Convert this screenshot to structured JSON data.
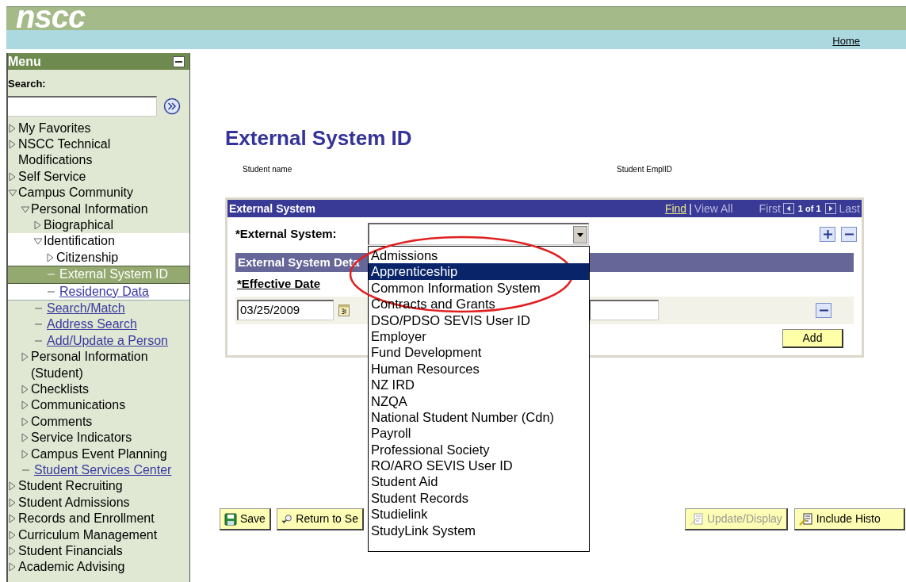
{
  "header": {
    "logo": "nscc",
    "home_link": "Home"
  },
  "menu": {
    "title": "Menu",
    "search_label": "Search:",
    "items": [
      {
        "label": "My Favorites",
        "kind": "folder",
        "expanded": false,
        "selected": false
      },
      {
        "label": "NSCC Technical Modifications",
        "kind": "folder",
        "expanded": false,
        "selected": false
      },
      {
        "label": "Self Service",
        "kind": "folder",
        "expanded": false,
        "selected": false
      },
      {
        "label": "Campus Community",
        "kind": "folder",
        "expanded": true,
        "selected": false,
        "children": [
          {
            "label": "Personal Information",
            "kind": "folder",
            "expanded": true,
            "selected": false,
            "children": [
              {
                "label": "Biographical",
                "kind": "folder",
                "expanded": false,
                "selected": false
              },
              {
                "label": "Identification",
                "kind": "folder",
                "expanded": true,
                "selected": false,
                "children": [
                  {
                    "label": "Citizenship",
                    "kind": "folder",
                    "expanded": false,
                    "selected": false
                  },
                  {
                    "label": "External System ID",
                    "kind": "link",
                    "selected": true
                  },
                  {
                    "label": "Residency Data",
                    "kind": "link",
                    "selected": false
                  }
                ]
              },
              {
                "label": "Search/Match",
                "kind": "link",
                "selected": false
              },
              {
                "label": "Address Search",
                "kind": "link",
                "selected": false
              },
              {
                "label": "Add/Update a Person",
                "kind": "link",
                "selected": false
              }
            ]
          },
          {
            "label": "Personal Information (Student)",
            "kind": "folder",
            "expanded": false,
            "selected": false
          },
          {
            "label": "Checklists",
            "kind": "folder",
            "expanded": false,
            "selected": false
          },
          {
            "label": "Communications",
            "kind": "folder",
            "expanded": false,
            "selected": false
          },
          {
            "label": "Comments",
            "kind": "folder",
            "expanded": false,
            "selected": false
          },
          {
            "label": "Service Indicators",
            "kind": "folder",
            "expanded": false,
            "selected": false
          },
          {
            "label": "Campus Event Planning",
            "kind": "folder",
            "expanded": false,
            "selected": false
          },
          {
            "label": "Student Services Center",
            "kind": "link",
            "selected": false
          }
        ]
      },
      {
        "label": "Student Recruiting",
        "kind": "folder",
        "expanded": false,
        "selected": false
      },
      {
        "label": "Student Admissions",
        "kind": "folder",
        "expanded": false,
        "selected": false
      },
      {
        "label": "Records and Enrollment",
        "kind": "folder",
        "expanded": false,
        "selected": false
      },
      {
        "label": "Curriculum Management",
        "kind": "folder",
        "expanded": false,
        "selected": false
      },
      {
        "label": "Student Financials",
        "kind": "folder",
        "expanded": false,
        "selected": false
      },
      {
        "label": "Academic Advising",
        "kind": "folder",
        "expanded": false,
        "selected": false
      }
    ]
  },
  "page": {
    "title": "External System ID",
    "student_name_label": "Student name",
    "emplid_label": "Student EmplID"
  },
  "panel": {
    "title": "External System",
    "find": "Find",
    "separator": "|",
    "view_all": "View All",
    "first": "First",
    "count": "1 of 1",
    "last": "Last",
    "field_label": "*External System:",
    "options": [
      {
        "label": "Admissions",
        "selected": false
      },
      {
        "label": "Apprenticeship",
        "selected": true
      },
      {
        "label": "Common Information System",
        "selected": false
      },
      {
        "label": "Contracts and Grants",
        "selected": false
      },
      {
        "label": "DSO/PDSO SEVIS User ID",
        "selected": false
      },
      {
        "label": "Employer",
        "selected": false
      },
      {
        "label": "Fund Development",
        "selected": false
      },
      {
        "label": "Human Resources",
        "selected": false
      },
      {
        "label": "NZ IRD",
        "selected": false
      },
      {
        "label": "NZQA",
        "selected": false
      },
      {
        "label": "National Student Number (Cdn)",
        "selected": false
      },
      {
        "label": "Payroll",
        "selected": false
      },
      {
        "label": "Professional Society",
        "selected": false
      },
      {
        "label": "RO/ARO SEVIS User ID",
        "selected": false
      },
      {
        "label": "Student Aid",
        "selected": false
      },
      {
        "label": "Student Records",
        "selected": false
      },
      {
        "label": "Studielink",
        "selected": false
      },
      {
        "label": "StudyLink System",
        "selected": false
      }
    ],
    "details_title": "External System Deta",
    "effective_date_label": "*Effective Date",
    "date_value": "03/25/2009",
    "add_button": "Add"
  },
  "buttons": [
    {
      "label": "Save",
      "kind": "save",
      "disabled": false
    },
    {
      "label": "Return to Se",
      "kind": "return",
      "disabled": false
    },
    {
      "label": "Update/Display",
      "kind": "update",
      "disabled": true
    },
    {
      "label": "Include Histo",
      "kind": "history",
      "disabled": false
    }
  ]
}
